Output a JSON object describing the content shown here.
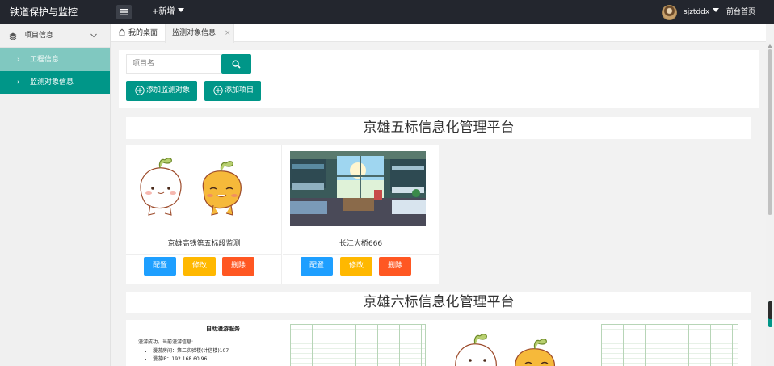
{
  "app": {
    "title": "铁道保护与监控",
    "add_new": "+新增",
    "username": "sjztddx",
    "front_home": "前台首页"
  },
  "sidebar": {
    "group_label": "项目信息",
    "items": [
      {
        "label": "工程信息",
        "active": false
      },
      {
        "label": "监测对象信息",
        "active": true
      }
    ]
  },
  "tabs": [
    {
      "label": "我的桌面"
    },
    {
      "label": "监测对象信息",
      "close": "×"
    }
  ],
  "toolbar": {
    "search_placeholder": "项目名",
    "add_monitor_label": "添加监测对象",
    "add_project_label": "添加项目"
  },
  "sections": [
    {
      "title": "京雄五标信息化管理平台",
      "cards": [
        {
          "name": "京雄高铁第五标段监测",
          "image": "cartoon-mascots"
        },
        {
          "name": "长江大桥666",
          "image": "anime-dorm-room"
        }
      ]
    },
    {
      "title": "京雄六标信息化管理平台"
    }
  ],
  "card_actions": {
    "config": "配置",
    "edit": "修改",
    "delete": "删除"
  },
  "doc_preview": {
    "title": "自助漫游服务",
    "line1": "漫游成功。当前漫游信息:",
    "bullet1": "漫游房间：第二实验楼(计信楼)107",
    "bullet2": "漫游IP：192.168.60.96"
  },
  "colors": {
    "topbar": "#23262e",
    "primary": "#009688",
    "sidebar_active": "#009688",
    "sidebar_sub": "#80c8c0",
    "config_btn": "#1e9fff",
    "edit_btn": "#ffb800",
    "delete_btn": "#ff5722"
  }
}
